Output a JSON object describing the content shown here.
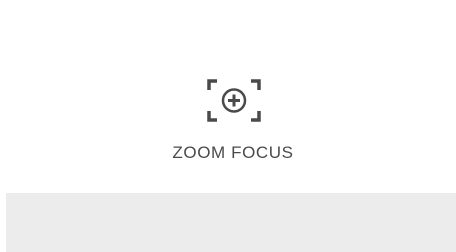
{
  "zoom_focus": {
    "label": "ZOOM FOCUS",
    "icon": "zoom-focus-icon",
    "icon_color": "#4a4a4a"
  },
  "colors": {
    "background": "#ffffff",
    "bottom_panel": "#ececec",
    "label": "#4a4a4a"
  }
}
